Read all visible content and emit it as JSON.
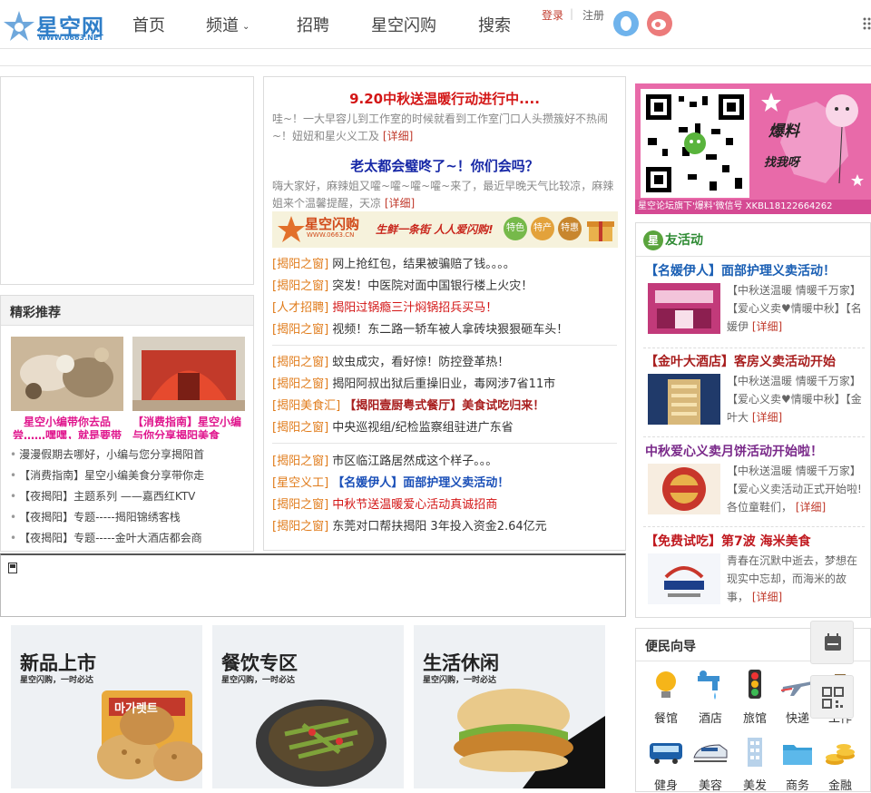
{
  "header": {
    "logo_text": "星空网",
    "logo_url": "WWW.0663.NET",
    "nav": [
      "首页",
      "频道",
      "招聘",
      "星空闪购",
      "搜索"
    ],
    "login": "登录",
    "sep": "|",
    "register": "注册"
  },
  "recommend": {
    "title": "精彩推荐",
    "thumbs": [
      {
        "caption": "星空小编带你去品尝……嘿嘿，就是要带你"
      },
      {
        "caption": "【消费指南】星空小编与你分享揭阳美食"
      }
    ],
    "list": [
      "漫漫假期去哪好，小编与您分享揭阳首",
      "【消费指南】星空小编美食分享带你走",
      "【夜揭阳】主题系列 ——嘉西红KTV",
      "【夜揭阳】专题-----揭阳锦绣客栈",
      "【夜揭阳】专题-----金叶大酒店都会商"
    ]
  },
  "middle": {
    "headline1": "9.20中秋送温暖行动进行中....",
    "summary1": "哇~！一大早容儿到工作室的时候就看到工作室门口人头攒簇好不热闹~！妞妞和星火义工及",
    "headline2": "老太都会璧咚了~！你们会吗？",
    "summary2": "嗨大家好，麻辣姐又嚯~嚯~嚯~嚯~来了，最近早晚天气比较凉，麻辣姐来个温馨提醒，天凉",
    "more": "[详细]",
    "banner": {
      "brand": "星空闪购",
      "url": "WWW.0663.CN",
      "slogan": "生鲜一条街 人人爱闪购!",
      "badges": [
        "特色",
        "特产",
        "特惠"
      ]
    },
    "groups": [
      [
        {
          "tag": "[揭阳之窗]",
          "text": "网上抢红包，结果被骗赔了钱。。。。",
          "style": "normal"
        },
        {
          "tag": "[揭阳之窗]",
          "text": "突发！中医院对面中国银行楼上火灾！",
          "style": "normal"
        },
        {
          "tag": "[人才招聘]",
          "text": "揭阳过锅瘾三汁焖锅招兵买马！",
          "style": "red"
        },
        {
          "tag": "[揭阳之窗]",
          "text": "视频！东二路一轿车被人拿砖块狠狠砸车头！",
          "style": "normal"
        }
      ],
      [
        {
          "tag": "[揭阳之窗]",
          "text": "蚊虫成灾，看好惊！防控登革热！",
          "style": "normal"
        },
        {
          "tag": "[揭阳之窗]",
          "text": "揭阳阿叔出狱后重操旧业，毒网涉7省11市",
          "style": "normal"
        },
        {
          "tag": "[揭阳美食汇]",
          "text": "【揭阳壹厨粤式餐厅】美食试吃归来！",
          "style": "darkred"
        },
        {
          "tag": "[揭阳之窗]",
          "text": "中央巡视组/纪检监察组驻进广东省",
          "style": "normal"
        }
      ],
      [
        {
          "tag": "[揭阳之窗]",
          "text": "市区临江路居然成这个样子。。。",
          "style": "normal"
        },
        {
          "tag": "[星空义工]",
          "text": "【名媛伊人】面部护理义卖活动！",
          "style": "blue"
        },
        {
          "tag": "[揭阳之窗]",
          "text": "中秋节送温暖爱心活动真诚招商",
          "style": "red"
        },
        {
          "tag": "[揭阳之窗]",
          "text": "东莞对口帮扶揭阳 3年投入资金2.64亿元",
          "style": "normal"
        }
      ]
    ]
  },
  "cards": [
    {
      "title": "新品上市",
      "sub": "星空闪购，一时必达",
      "product": "마가렛트"
    },
    {
      "title": "餐饮专区",
      "sub": "星空闪购，一时必达"
    },
    {
      "title": "生活休闲",
      "sub": "星空闪购，一时必达"
    }
  ],
  "qr": {
    "text1": "爆料",
    "text2": "找我呀",
    "caption": "星空论坛旗下'爆料'微信号 XKBL18122664262"
  },
  "activities": {
    "title_char": "星",
    "title": "友活动",
    "items": [
      {
        "title": "【名媛伊人】面部护理义卖活动！",
        "color": "#1a5fb4",
        "text": "【中秋送温暖 情暖千万家】【爱心义卖♥情暖中秋】【名媛伊",
        "more": "[详细]"
      },
      {
        "title": "【金叶大酒店】客房义卖活动开始",
        "color": "#a81e1e",
        "text": "【中秋送温暖 情暖千万家】【爱心义卖♥情暖中秋】【金叶大",
        "more": "[详细]"
      },
      {
        "title": "中秋爱心义卖月饼活动开始啦！",
        "color": "#7a2a8a",
        "text": "【中秋送温暖 情暖千万家】【爱心义卖活动正式开始啦!各位童鞋们，",
        "more": "[详细]"
      },
      {
        "title": "【免费试吃】第7波 海米美食",
        "color": "#c0181e",
        "text": "青春在沉默中逝去，梦想在现实中忘却，而海米的故事，",
        "more": "[详细]"
      }
    ]
  },
  "convenience": {
    "title": "便民向导",
    "row1": [
      "餐馆",
      "酒店",
      "旅馆",
      "快递",
      "工作"
    ],
    "row2": [
      "健身",
      "美容",
      "美发",
      "商务",
      "金融"
    ]
  }
}
